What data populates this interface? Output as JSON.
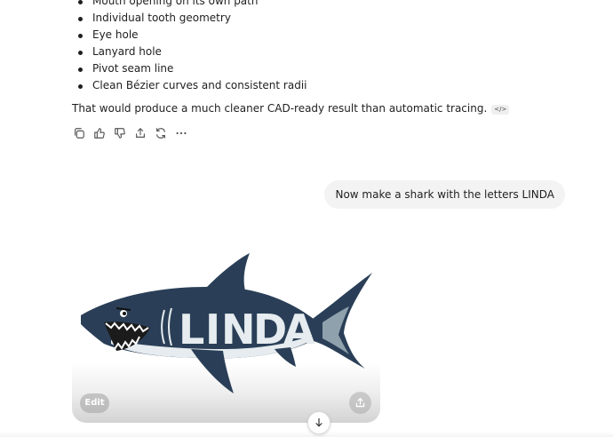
{
  "assistant": {
    "bullets": [
      "Mouth opening on its own path",
      "Individual tooth geometry",
      "Eye hole",
      "Lanyard hole",
      "Pivot seam line",
      "Clean Bézier curves and consistent radii"
    ],
    "summary": "That would produce a much cleaner CAD-ready result than automatic tracing.",
    "code_chip": "</>",
    "actions": [
      "copy-icon",
      "thumbs-up-icon",
      "thumbs-down-icon",
      "share-icon",
      "regenerate-icon",
      "more-icon"
    ]
  },
  "user_message": "Now make a shark with the letters LINDA",
  "image_result": {
    "letters": [
      "L",
      "I",
      "N",
      "D",
      "A"
    ],
    "shark_color": "#2a3f57",
    "belly_color": "#e6ecef",
    "edit_label": "Edit"
  },
  "icons": {
    "share": "share-icon",
    "scroll": "arrow-down-icon"
  }
}
